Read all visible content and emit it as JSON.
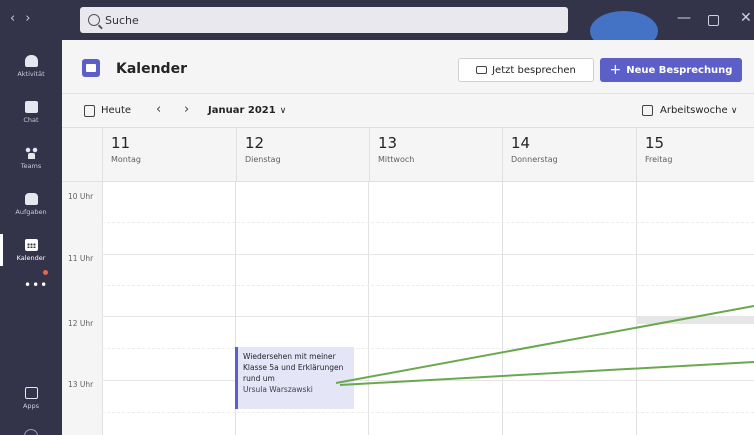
{
  "titlebar": {
    "search_placeholder": "Suche"
  },
  "rail": {
    "items": [
      {
        "label": "Aktivität"
      },
      {
        "label": "Chat"
      },
      {
        "label": "Teams"
      },
      {
        "label": "Aufgaben"
      },
      {
        "label": "Kalender"
      },
      {
        "label": "Apps"
      }
    ],
    "more": "•••"
  },
  "header": {
    "title": "Kalender",
    "meet_now": "Jetzt besprechen",
    "new_meeting": "Neue Besprechung"
  },
  "toolbar": {
    "today": "Heute",
    "month": "Januar 2021",
    "view": "Arbeitswoche"
  },
  "days": [
    {
      "num": "11",
      "name": "Montag"
    },
    {
      "num": "12",
      "name": "Dienstag"
    },
    {
      "num": "13",
      "name": "Mittwoch"
    },
    {
      "num": "14",
      "name": "Donnerstag"
    },
    {
      "num": "15",
      "name": "Freitag"
    }
  ],
  "times": [
    "10 Uhr",
    "11 Uhr",
    "12 Uhr",
    "13 Uhr"
  ],
  "event": {
    "title": "Wiedersehen mit meiner Klasse 5a und Erklärungen rund um",
    "organizer": "Ursula Warszawski"
  },
  "colors": {
    "rail_bg": "#33344a",
    "accent": "#5b5fc7",
    "avatar": "#4472c4",
    "annotation_line": "#6aa84f",
    "event_bg": "#e4e5f7"
  }
}
